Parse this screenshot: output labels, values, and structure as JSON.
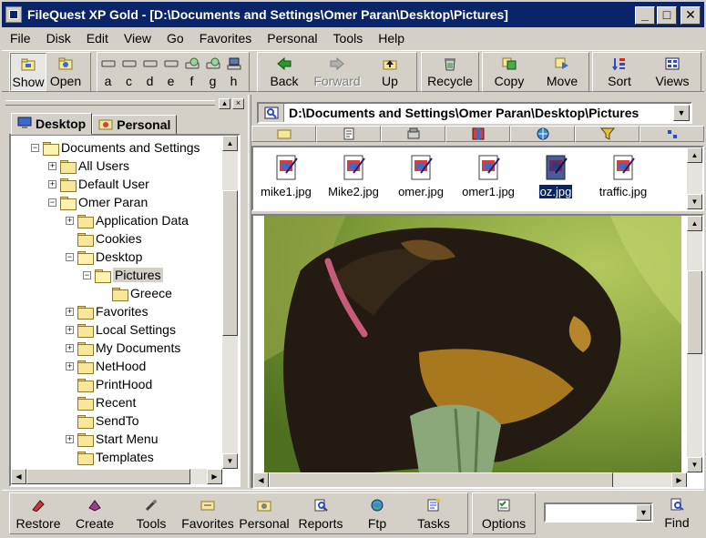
{
  "window": {
    "title": "FileQuest XP Gold - [D:\\Documents and Settings\\Omer Paran\\Desktop\\Pictures]",
    "minimize": "_",
    "maximize": "□",
    "close": "✕"
  },
  "menu": [
    "File",
    "Disk",
    "Edit",
    "View",
    "Go",
    "Favorites",
    "Personal",
    "Tools",
    "Help"
  ],
  "toolbar": {
    "show_label": "Show",
    "open_label": "Open",
    "drives": [
      "a",
      "c",
      "d",
      "e",
      "f",
      "g",
      "h"
    ],
    "nav": [
      {
        "label": "Back",
        "icon": "back-arrow-icon",
        "disabled": false
      },
      {
        "label": "Forward",
        "icon": "forward-arrow-icon",
        "disabled": true
      },
      {
        "label": "Up",
        "icon": "up-folder-icon",
        "disabled": false
      }
    ],
    "actions": [
      {
        "label": "Recycle",
        "icon": "recycle-icon"
      },
      {
        "label": "Copy",
        "icon": "copy-icon"
      },
      {
        "label": "Move",
        "icon": "move-icon"
      },
      {
        "label": "Sort",
        "icon": "sort-icon"
      },
      {
        "label": "Views",
        "icon": "views-icon"
      }
    ]
  },
  "left_pane": {
    "tabs": [
      {
        "label": "Desktop",
        "active": true
      },
      {
        "label": "Personal",
        "active": false
      }
    ],
    "tree": [
      {
        "label": "Documents and Settings",
        "level": 1,
        "exp": "−",
        "open": true
      },
      {
        "label": "All Users",
        "level": 2,
        "exp": "+"
      },
      {
        "label": "Default User",
        "level": 2,
        "exp": "+"
      },
      {
        "label": "Omer Paran",
        "level": 2,
        "exp": "−",
        "open": true
      },
      {
        "label": "Application Data",
        "level": 3,
        "exp": "+"
      },
      {
        "label": "Cookies",
        "level": 3,
        "exp": ""
      },
      {
        "label": "Desktop",
        "level": 3,
        "exp": "−",
        "open": true
      },
      {
        "label": "Pictures",
        "level": 4,
        "exp": "−",
        "open": true,
        "selected": true
      },
      {
        "label": "Greece",
        "level": 5,
        "exp": ""
      },
      {
        "label": "Favorites",
        "level": 3,
        "exp": "+"
      },
      {
        "label": "Local Settings",
        "level": 3,
        "exp": "+"
      },
      {
        "label": "My Documents",
        "level": 3,
        "exp": "+"
      },
      {
        "label": "NetHood",
        "level": 3,
        "exp": "+"
      },
      {
        "label": "PrintHood",
        "level": 3,
        "exp": ""
      },
      {
        "label": "Recent",
        "level": 3,
        "exp": ""
      },
      {
        "label": "SendTo",
        "level": 3,
        "exp": ""
      },
      {
        "label": "Start Menu",
        "level": 3,
        "exp": "+"
      },
      {
        "label": "Templates",
        "level": 3,
        "exp": ""
      }
    ]
  },
  "right_pane": {
    "path": "D:\\Documents and Settings\\Omer Paran\\Desktop\\Pictures",
    "files": [
      {
        "name": "mike1.jpg",
        "selected": false
      },
      {
        "name": "Mike2.jpg",
        "selected": false
      },
      {
        "name": "omer.jpg",
        "selected": false
      },
      {
        "name": "omer1.jpg",
        "selected": false
      },
      {
        "name": "oz.jpg",
        "selected": true
      },
      {
        "name": "traffic.jpg",
        "selected": false
      }
    ]
  },
  "bottom_toolbar": [
    {
      "label": "Restore",
      "icon": "restore-icon"
    },
    {
      "label": "Create",
      "icon": "create-icon"
    },
    {
      "label": "Tools",
      "icon": "tools-icon"
    },
    {
      "label": "Favorites",
      "icon": "favorites-icon"
    },
    {
      "label": "Personal",
      "icon": "personal-icon"
    },
    {
      "label": "Reports",
      "icon": "reports-icon"
    },
    {
      "label": "Ftp",
      "icon": "ftp-icon"
    },
    {
      "label": "Tasks",
      "icon": "tasks-icon"
    },
    {
      "label": "Options",
      "icon": "options-icon"
    }
  ],
  "find": {
    "label": "Find",
    "value": ""
  },
  "colors": {
    "titlebar": "#0a246a",
    "face": "#d4d0c8",
    "selection": "#0a246a"
  }
}
